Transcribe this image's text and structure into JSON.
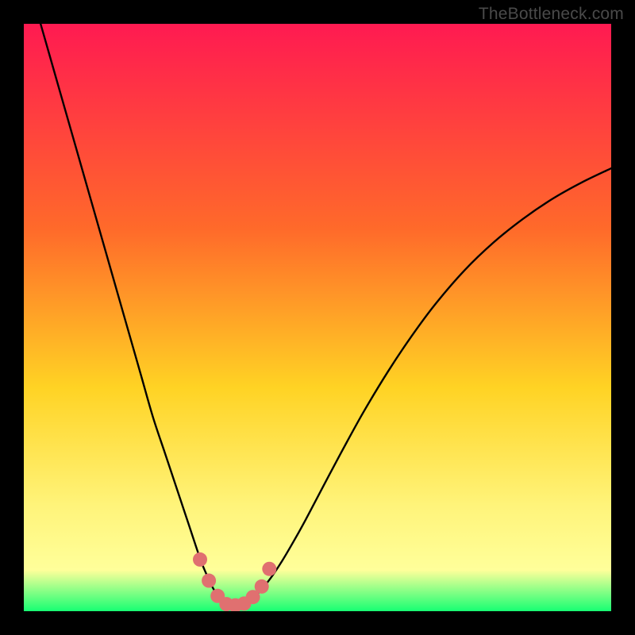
{
  "watermark": "TheBottleneck.com",
  "colors": {
    "background": "#000000",
    "gradient_top": "#ff1a51",
    "gradient_mid1": "#ff6a2a",
    "gradient_mid2": "#ffd324",
    "gradient_mid3": "#fff47a",
    "gradient_bottom": "#17ff73",
    "curve": "#000000",
    "marker_fill": "#e07070",
    "marker_stroke": "#b55050"
  },
  "chart_data": {
    "type": "line",
    "title": "",
    "xlabel": "",
    "ylabel": "",
    "xlim": [
      0,
      100
    ],
    "ylim": [
      0,
      100
    ],
    "series": [
      {
        "name": "bottleneck-curve",
        "x": [
          0,
          2,
          4,
          6,
          8,
          10,
          12,
          14,
          16,
          18,
          20,
          22,
          24,
          26,
          28,
          30,
          31,
          32,
          33,
          34,
          35,
          36,
          37,
          38,
          40,
          42,
          44,
          46,
          48,
          50,
          52,
          55,
          58,
          62,
          66,
          70,
          75,
          80,
          85,
          90,
          95,
          100
        ],
        "values": [
          110,
          103,
          96,
          89,
          82,
          75,
          68,
          61,
          54,
          47,
          40,
          33,
          27,
          21,
          15,
          9,
          6.5,
          4.3,
          2.7,
          1.6,
          1.0,
          1.0,
          1.2,
          1.7,
          3.2,
          5.6,
          8.6,
          12,
          15.6,
          19.4,
          23.2,
          28.8,
          34.2,
          40.8,
          46.8,
          52.2,
          58.0,
          62.8,
          66.8,
          70.2,
          73.0,
          75.4
        ]
      }
    ],
    "markers": {
      "name": "highlighted-points",
      "x": [
        30.0,
        31.5,
        33.0,
        34.5,
        36.0,
        37.5,
        39.0,
        40.5,
        41.8
      ],
      "values": [
        8.8,
        5.2,
        2.6,
        1.2,
        1.0,
        1.3,
        2.4,
        4.2,
        7.2
      ]
    }
  }
}
